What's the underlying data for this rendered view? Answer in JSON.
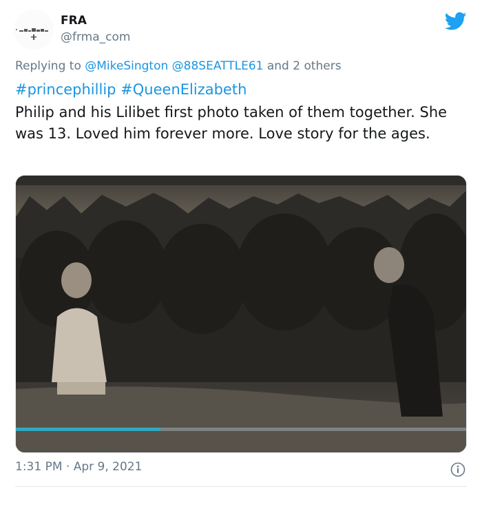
{
  "author": {
    "display_name": "FRA",
    "handle": "@frma_com"
  },
  "reply": {
    "prefix": "Replying to",
    "mentions": "@MikeSington @88SEATTLE61",
    "suffix": "and 2 others"
  },
  "tweet": {
    "hashtag_1": "#princephillip",
    "hashtag_2": "#QueenElizabeth",
    "text": "Philip and his Lilibet first photo taken of them together. She was 13. Loved him forever more. Love story for the ages."
  },
  "media": {
    "type": "video",
    "progress_fraction": 0.32,
    "progress_color": "#2fa9c2"
  },
  "meta": {
    "timestamp": "1:31 PM · Apr 9, 2021"
  },
  "colors": {
    "brand": "#1da1f2",
    "link": "#1b95e0",
    "muted": "#657786"
  },
  "icons": {
    "brand": "twitter-bird-icon",
    "info": "info-icon"
  }
}
